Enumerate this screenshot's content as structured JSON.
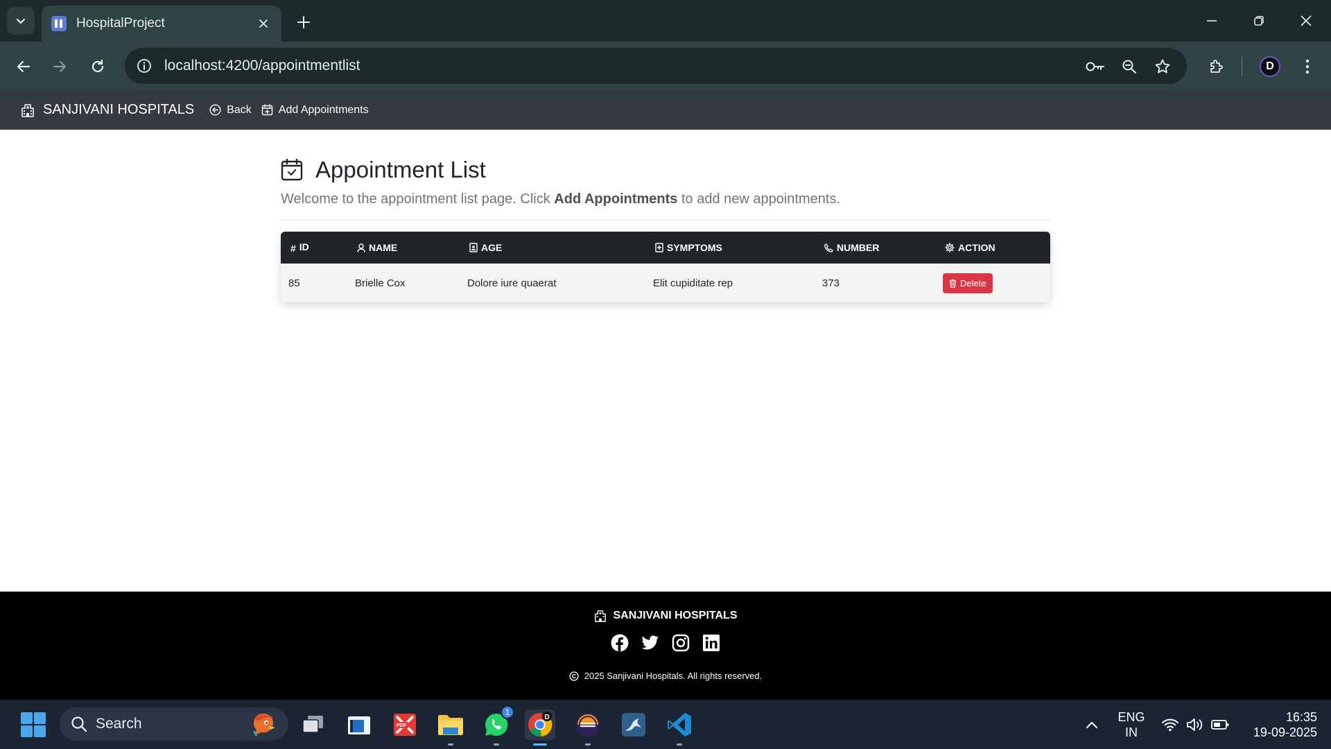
{
  "browser": {
    "tab_title": "HospitalProject",
    "url": "localhost:4200/appointmentlist"
  },
  "navbar": {
    "brand": "SANJIVANI HOSPITALS",
    "back_label": "Back",
    "add_label": "Add Appointments"
  },
  "page": {
    "title": "Appointment List",
    "lead_prefix": "Welcome to the appointment list page. Click ",
    "lead_bold": "Add Appointments",
    "lead_suffix": " to add new appointments."
  },
  "table": {
    "headers": {
      "id": "ID",
      "name": "NAME",
      "age": "AGE",
      "symptoms": "SYMPTOMS",
      "number": "NUMBER",
      "action": "ACTION"
    },
    "rows": [
      {
        "id": "85",
        "name": "Brielle Cox",
        "age": "Dolore iure quaerat",
        "symptoms": "Elit cupiditate rep",
        "number": "373",
        "action_label": "Delete"
      }
    ]
  },
  "footer": {
    "brand": "SANJIVANI HOSPITALS",
    "copyright": "2025 Sanjivani Hospitals. All rights reserved."
  },
  "taskbar": {
    "search_label": "Search",
    "whatsapp_badge": "1",
    "lang_top": "ENG",
    "lang_bottom": "IN",
    "time": "16:35",
    "date": "19-09-2025"
  },
  "colors": {
    "navbar_bg": "#343a40",
    "table_header_bg": "#212529",
    "delete_button": "#dc3545",
    "footer_bg": "#000000"
  }
}
